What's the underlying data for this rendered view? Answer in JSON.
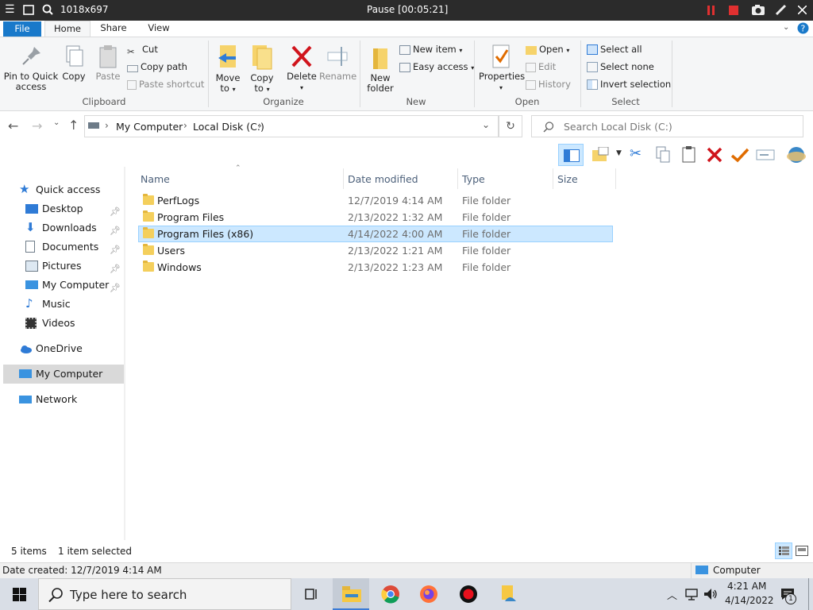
{
  "topbar": {
    "resolution": "1018x697",
    "title": "Pause [00:05:21]"
  },
  "ribbon_tabs": [
    "File",
    "Home",
    "Share",
    "View"
  ],
  "ribbon": {
    "clipboard": {
      "pin_line1": "Pin to Quick",
      "pin_line2": "access",
      "copy": "Copy",
      "paste": "Paste",
      "cut": "Cut",
      "copy_path": "Copy path",
      "paste_shortcut": "Paste shortcut",
      "label": "Clipboard"
    },
    "organize": {
      "move_line1": "Move",
      "move_line2": "to",
      "copy_line1": "Copy",
      "copy_line2": "to",
      "delete": "Delete",
      "rename": "Rename",
      "label": "Organize"
    },
    "new": {
      "folder_line1": "New",
      "folder_line2": "folder",
      "new_item": "New item",
      "easy_access": "Easy access",
      "label": "New"
    },
    "open": {
      "properties": "Properties",
      "open": "Open",
      "edit": "Edit",
      "history": "History",
      "label": "Open"
    },
    "select": {
      "select_all": "Select all",
      "select_none": "Select none",
      "invert": "Invert selection",
      "label": "Select"
    }
  },
  "address": {
    "crumbs": [
      "My Computer",
      "Local Disk (C:)"
    ],
    "search_placeholder": "Search Local Disk (C:)"
  },
  "nav": {
    "quick_access": "Quick access",
    "items": [
      "Desktop",
      "Downloads",
      "Documents",
      "Pictures",
      "My Computer",
      "Music",
      "Videos"
    ],
    "onedrive": "OneDrive",
    "my_computer": "My Computer",
    "network": "Network"
  },
  "columns": {
    "name": "Name",
    "date": "Date modified",
    "type": "Type",
    "size": "Size"
  },
  "files": [
    {
      "name": "PerfLogs",
      "date": "12/7/2019 4:14 AM",
      "type": "File folder"
    },
    {
      "name": "Program Files",
      "date": "2/13/2022 1:32 AM",
      "type": "File folder"
    },
    {
      "name": "Program Files (x86)",
      "date": "4/14/2022 4:00 AM",
      "type": "File folder"
    },
    {
      "name": "Users",
      "date": "2/13/2022 1:21 AM",
      "type": "File folder"
    },
    {
      "name": "Windows",
      "date": "2/13/2022 1:23 AM",
      "type": "File folder"
    }
  ],
  "status": {
    "count": "5 items",
    "selected": "1 item selected"
  },
  "info": {
    "date_created": "Date created: 12/7/2019 4:14 AM",
    "location": "Computer"
  },
  "taskbar": {
    "search": "Type here to search",
    "time": "4:21 AM",
    "date": "4/14/2022",
    "notif_count": "1"
  }
}
